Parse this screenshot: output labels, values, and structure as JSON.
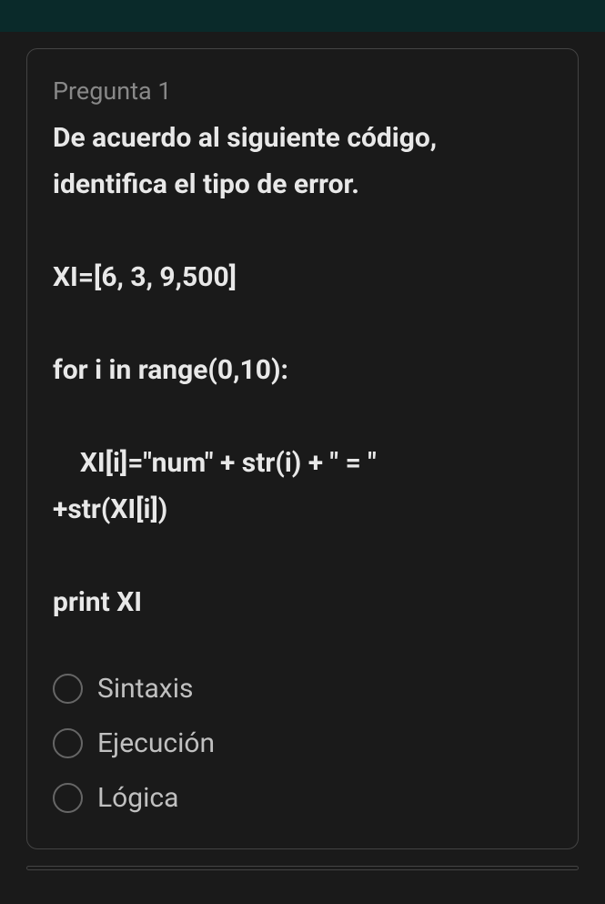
{
  "question": {
    "label": "Pregunta 1",
    "prompt": "De acuerdo al siguiente código, identifica el tipo de error.",
    "code_lines": {
      "l1": "XI=[6, 3, 9,500]",
      "l2": "for i in range(0,10):",
      "l3a": "    XI[i]=\"num\" + str(i) + \" = \"",
      "l3b": "+str(XI[i])",
      "l4": "print XI"
    },
    "options": [
      {
        "label": "Sintaxis"
      },
      {
        "label": "Ejecución"
      },
      {
        "label": "Lógica"
      }
    ]
  }
}
